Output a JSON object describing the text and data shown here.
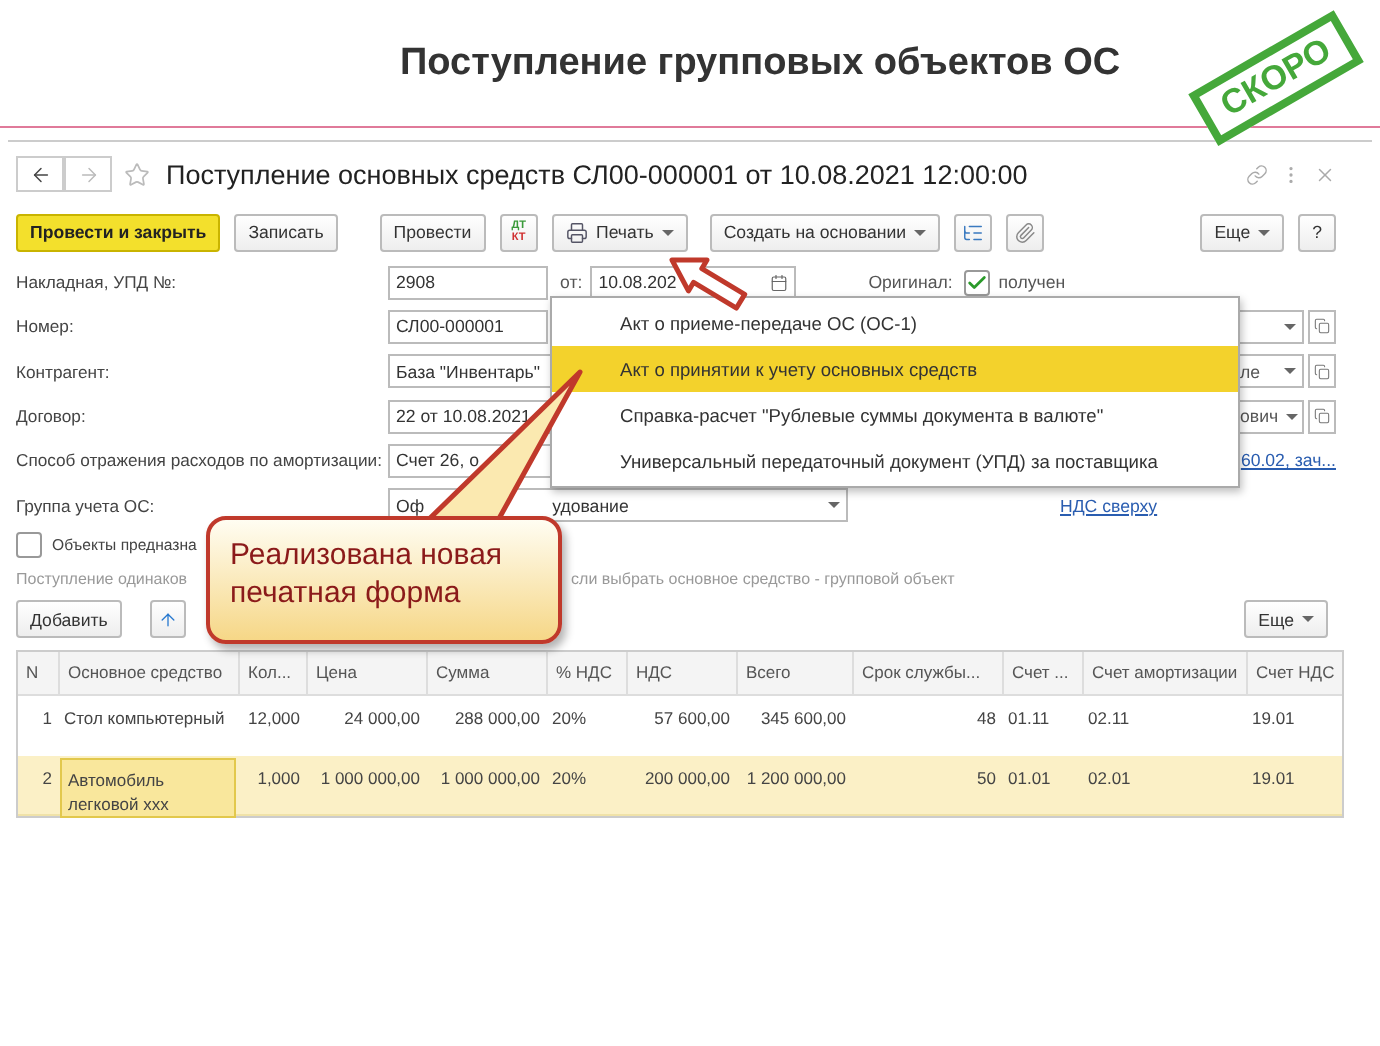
{
  "slide_title": "Поступление групповых объектов ОС",
  "stamp": "СКОРО",
  "window": {
    "title": "Поступление основных средств СЛ00-000001 от 10.08.2021 12:00:00"
  },
  "toolbar": {
    "buttons": [
      {
        "kind": "primary",
        "label": "Провести и закрыть"
      },
      {
        "kind": "plain",
        "label": "Записать"
      },
      {
        "kind": "plain",
        "label": "Провести"
      },
      {
        "kind": "dtkt",
        "top": "ДТ",
        "bottom": "КТ"
      },
      {
        "kind": "print",
        "label": "Печать"
      },
      {
        "kind": "dropdown",
        "label": "Создать на основании"
      },
      {
        "kind": "structure"
      },
      {
        "kind": "attach"
      },
      {
        "kind": "more",
        "label": "Еще"
      },
      {
        "kind": "help",
        "label": "?"
      }
    ]
  },
  "form": {
    "invoice": {
      "label": "Накладная, УПД №:",
      "value": "2908",
      "date_label": "от:",
      "date": "10.08.202",
      "original_label": "Оригинал:",
      "original_checked": true,
      "original_text": "получен"
    },
    "number": {
      "label": "Номер:",
      "value": "СЛ00-000001"
    },
    "counterparty": {
      "label": "Контрагент:",
      "value": "База \"Инвентарь\"",
      "right_value": "ле"
    },
    "contract": {
      "label": "Договор:",
      "value": "22 от 10.08.2021",
      "right_value": "ович"
    },
    "depreciation": {
      "label": "Способ отражения расходов по амортизации:",
      "value": "Счет 26, о",
      "right_link": "60.02, зач..."
    },
    "group": {
      "label": "Группа учета ОС:",
      "value": "Оф",
      "value_tail": "удование",
      "right_link": "НДС сверху"
    },
    "objects": {
      "label": "Объекты предназна",
      "checked": false
    },
    "note": {
      "text": "Поступление одинаков",
      "tail": "сли выбрать основное средство - групповой объект"
    }
  },
  "table_toolbar": {
    "add": "Добавить",
    "more": "Еще"
  },
  "table": {
    "columns": [
      {
        "label": "N",
        "kind": "number"
      },
      {
        "label": "Основное средство",
        "kind": "text"
      },
      {
        "label": "Кол...",
        "kind": "number"
      },
      {
        "label": "Цена",
        "kind": "number"
      },
      {
        "label": "Сумма",
        "kind": "number"
      },
      {
        "label": "% НДС",
        "kind": "text"
      },
      {
        "label": "НДС",
        "kind": "number"
      },
      {
        "label": "Всего",
        "kind": "number"
      },
      {
        "label": "Срок службы...",
        "kind": "number"
      },
      {
        "label": "Счет ...",
        "kind": "text"
      },
      {
        "label": "Счет амортизации",
        "kind": "text"
      },
      {
        "label": "Счет НДС",
        "kind": "text"
      }
    ],
    "rows": [
      {
        "selected": false,
        "editing": false,
        "cells": [
          "1",
          "Стол компьютерный",
          "12,000",
          "24 000,00",
          "288 000,00",
          "20%",
          "57 600,00",
          "345 600,00",
          "48",
          "01.11",
          "02.11",
          "19.01"
        ]
      },
      {
        "selected": true,
        "editing": true,
        "cells": [
          "2",
          "Автомобиль легковой xxx",
          "1,000",
          "1 000 000,00",
          "1 000 000,00",
          "20%",
          "200 000,00",
          "1 200 000,00",
          "50",
          "01.01",
          "02.01",
          "19.01"
        ]
      }
    ]
  },
  "print_menu": {
    "items": [
      {
        "label": "Акт о приеме-передаче ОС (ОС-1)",
        "selected": false
      },
      {
        "label": "Акт о принятии к учету основных средств",
        "selected": true
      },
      {
        "label": "Справка-расчет \"Рублевые суммы документа в валюте\"",
        "selected": false
      },
      {
        "label": "Универсальный передаточный документ (УПД) за поставщика",
        "selected": false
      }
    ]
  },
  "callout": {
    "text": "Реализована новая печатная форма"
  }
}
